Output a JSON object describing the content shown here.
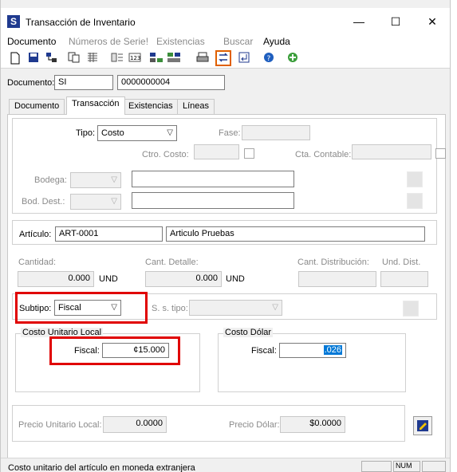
{
  "window": {
    "title": "Transacción de Inventario",
    "app_icon_letter": "S",
    "minimize": "—",
    "maximize": "☐",
    "close": "✕"
  },
  "menu": [
    "Documento",
    "Números de Serie!",
    "Existencias",
    "Buscar",
    "Ayuda"
  ],
  "toolbar": {
    "icons": [
      "new-doc-icon",
      "save-icon",
      "hierarchy-icon",
      "copy-icon",
      "grid-icon",
      "split-icon",
      "numbers-icon",
      "tree-icon",
      "multi-grid-icon",
      "print-icon",
      "swap-icon",
      "enter-icon",
      "help-icon",
      "add-icon"
    ]
  },
  "document": {
    "label": "Documento:",
    "type_value": "SI",
    "number_value": "0000000004"
  },
  "tabs": [
    "Documento",
    "Transacción",
    "Existencias",
    "Líneas"
  ],
  "transaction": {
    "tipo_label": "Tipo:",
    "tipo_value": "Costo",
    "fase_label": "Fase:",
    "ctro_costo_label": "Ctro. Costo:",
    "cta_contable_label": "Cta. Contable:",
    "bodega_label": "Bodega:",
    "bod_dest_label": "Bod. Dest.:"
  },
  "article": {
    "label": "Artículo:",
    "code": "ART-0001",
    "description": "Articulo Pruebas"
  },
  "quantities": {
    "cantidad_label": "Cantidad:",
    "cantidad_value": "0.000",
    "cantidad_unit": "UND",
    "cant_detalle_label": "Cant. Detalle:",
    "cant_detalle_value": "0.000",
    "cant_detalle_unit": "UND",
    "cant_distribucion_label": "Cant. Distribución:",
    "und_dist_label": "Und. Dist."
  },
  "subtype": {
    "label": "Subtipo:",
    "value": "Fiscal",
    "ss_tipo_label": "S. s. tipo:"
  },
  "cost_local": {
    "group_title": "Costo Unitario Local",
    "fiscal_label": "Fiscal:",
    "fiscal_value": "¢15.000"
  },
  "cost_dollar": {
    "group_title": "Costo Dólar",
    "fiscal_label": "Fiscal:",
    "fiscal_value": ".026"
  },
  "prices": {
    "precio_local_label": "Precio Unitario Local:",
    "precio_local_value": "0.0000",
    "precio_dolar_label": "Precio Dólar:",
    "precio_dolar_value": "$0.0000"
  },
  "status": {
    "text": "Costo unitario del artículo en moneda extranjera",
    "num": "NUM"
  },
  "colors": {
    "highlight_red": "#e00000",
    "selection_blue": "#0078d7"
  }
}
